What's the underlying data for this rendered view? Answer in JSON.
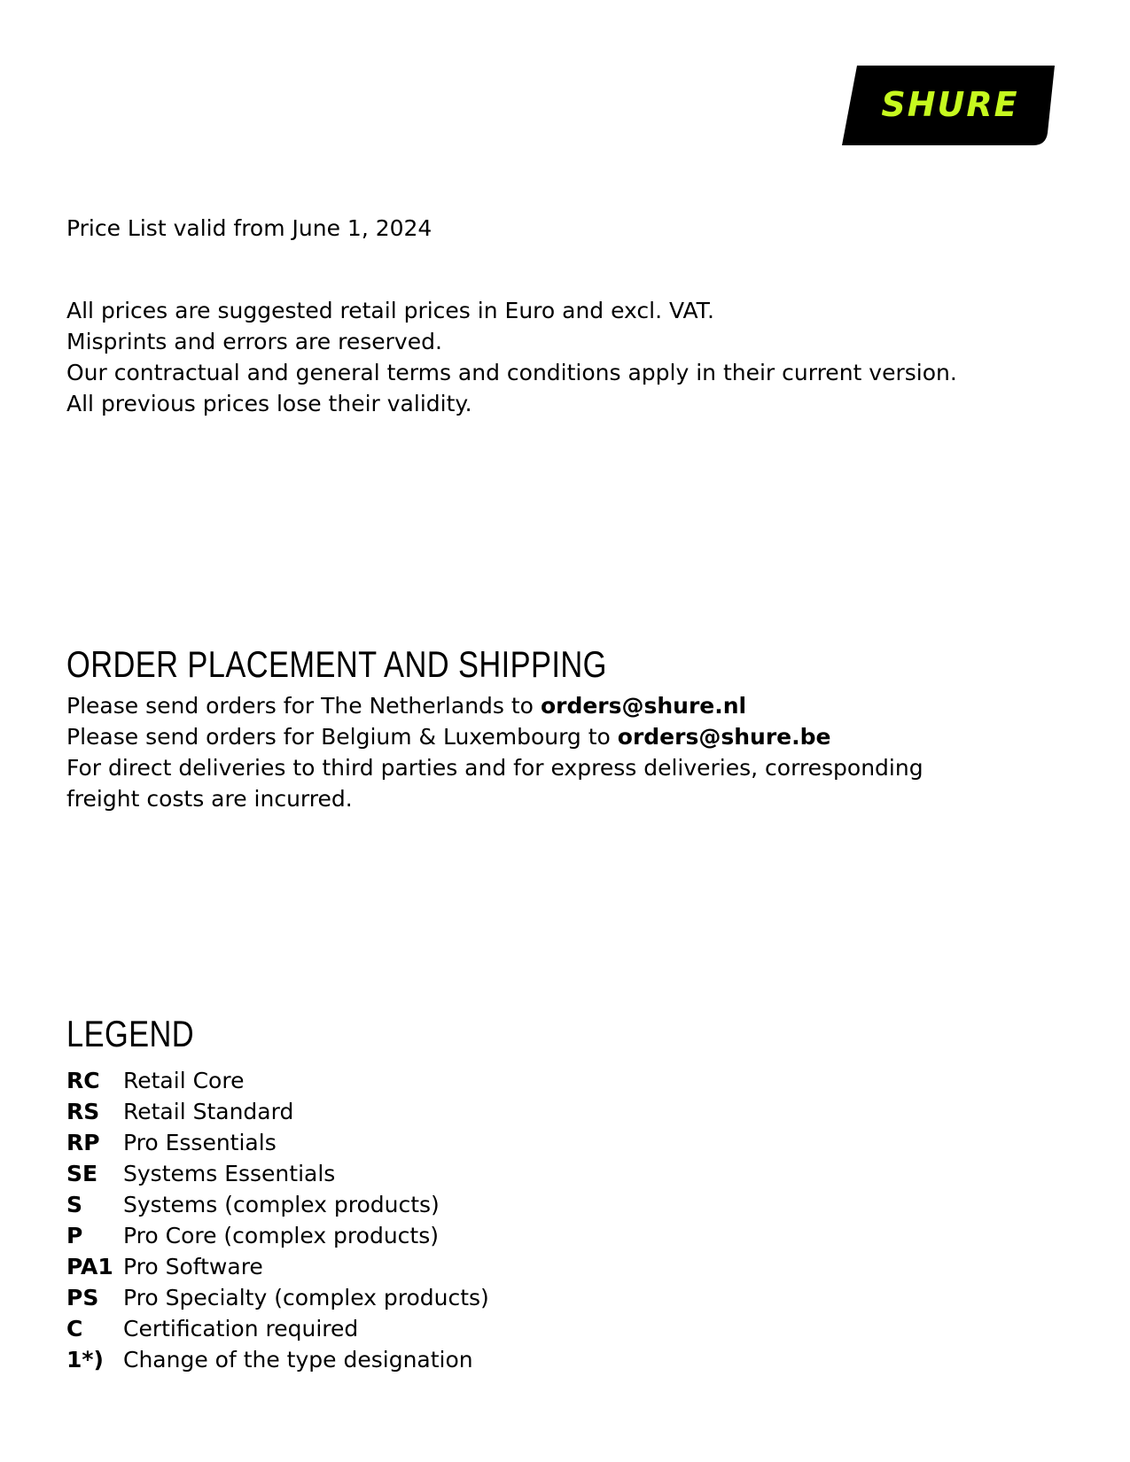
{
  "logo": {
    "text": "SHURE",
    "background_color": "#000000",
    "text_color": "#C6F91F"
  },
  "header": {
    "validity": "Price List valid from June 1, 2024"
  },
  "notes": [
    "All prices are suggested retail prices in Euro and excl. VAT.",
    "Misprints and errors are reserved.",
    "Our contractual and general terms and conditions apply in their current version.",
    "All previous prices lose their validity."
  ],
  "order": {
    "title": "ORDER PLACEMENT AND SHIPPING",
    "nl_prefix": "Please send orders for The Netherlands to ",
    "nl_email": "orders@shure.nl",
    "be_prefix": "Please send orders for Belgium & Luxembourg to ",
    "be_email": "orders@shure.be",
    "freight_note": "For direct deliveries to third parties and for express deliveries, corresponding freight costs are incurred."
  },
  "legend": {
    "title": "LEGEND",
    "items": [
      {
        "code": "RC",
        "label": "Retail Core"
      },
      {
        "code": "RS",
        "label": "Retail Standard"
      },
      {
        "code": "RP",
        "label": "Pro Essentials"
      },
      {
        "code": "SE",
        "label": "Systems Essentials"
      },
      {
        "code": "S",
        "label": "Systems (complex products)"
      },
      {
        "code": "P",
        "label": "Pro Core (complex products)"
      },
      {
        "code": "PA1",
        "label": "Pro Software"
      },
      {
        "code": "PS",
        "label": "Pro Specialty (complex products)"
      },
      {
        "code": "C",
        "label": "Certification required"
      },
      {
        "code": "1*)",
        "label": "Change of the type designation"
      }
    ]
  }
}
